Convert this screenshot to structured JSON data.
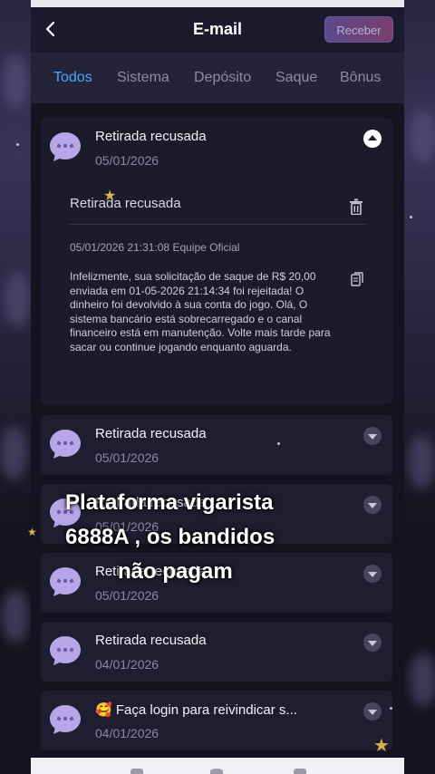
{
  "header": {
    "back_icon": "chevron-left-icon",
    "title": "E-mail",
    "receive_label": "Receber"
  },
  "tabs": [
    {
      "label": "Todos",
      "active": true
    },
    {
      "label": "Sistema",
      "active": false
    },
    {
      "label": "Depósito",
      "active": false
    },
    {
      "label": "Saque",
      "active": false
    },
    {
      "label": "Bônus",
      "active": false
    }
  ],
  "expanded_message": {
    "title": "Retirada recusada",
    "date": "05/01/2026",
    "detail_title": "Retirada recusada",
    "meta": "05/01/2026 21:31:08 Equipe Oficial",
    "body": "Infelizmente, sua solicitação de saque de R$ 20,00 enviada em 01-05-2026 21:14:34 foi rejeitada! O dinheiro foi devolvido à sua conta do jogo. Olá, O sistema bancário está sobrecarregado e o canal financeiro está em manutenção. Volte mais tarde para sacar ou continue jogando enquanto aguarda."
  },
  "messages": [
    {
      "title": "Retirada recusada",
      "date": "05/01/2026"
    },
    {
      "title": "Retirada recusada",
      "date": "05/01/2026"
    },
    {
      "title": "Retirada recusada",
      "date": "05/01/2026"
    },
    {
      "title": "Retirada recusada",
      "date": "04/01/2026"
    },
    {
      "title": "🥰 Faça login para reivindicar s...",
      "date": "04/01/2026"
    }
  ],
  "overlay": {
    "line1": "Plataforma vigarista",
    "line2": "6888A , os bandidos",
    "line3": "não pagam"
  },
  "colors": {
    "accent_tab": "#4aa6ff",
    "avatar": "#b7a6e8",
    "background": "#14131f"
  }
}
